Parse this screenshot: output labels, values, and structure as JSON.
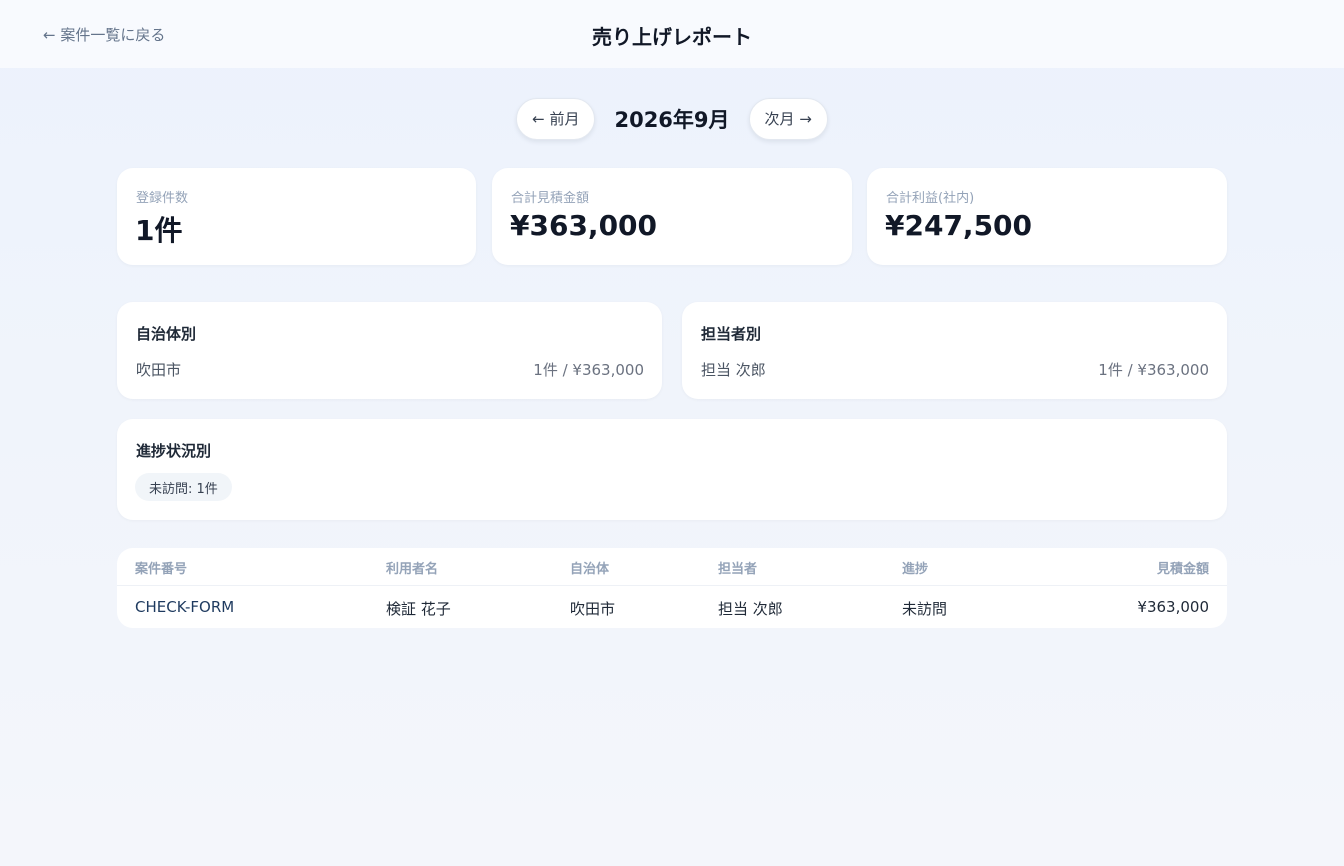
{
  "header": {
    "back_label": "← 案件一覧に戻る",
    "title": "売り上げレポート"
  },
  "month_nav": {
    "prev_label": "← 前月",
    "current": "2026年9月",
    "next_label": "次月 →"
  },
  "stats": [
    {
      "label": "登録件数",
      "value": "1件"
    },
    {
      "label": "合計見積金額",
      "value": "¥363,000"
    },
    {
      "label": "合計利益(社内)",
      "value": "¥247,500"
    }
  ],
  "by_municipality": {
    "title": "自治体別",
    "rows": [
      {
        "name": "吹田市",
        "value": "1件 / ¥363,000"
      }
    ]
  },
  "by_staff": {
    "title": "担当者別",
    "rows": [
      {
        "name": "担当 次郎",
        "value": "1件 / ¥363,000"
      }
    ]
  },
  "by_progress": {
    "title": "進捗状況別",
    "chips": [
      "未訪問: 1件"
    ]
  },
  "table": {
    "columns": [
      "案件番号",
      "利用者名",
      "自治体",
      "担当者",
      "進捗",
      "見積金額"
    ],
    "rows": [
      [
        "CHECK-FORM",
        "検証 花子",
        "吹田市",
        "担当 次郎",
        "未訪問",
        "¥363,000"
      ]
    ]
  },
  "colors": {
    "background": "#eef3fc",
    "card": "#ffffff",
    "title_text": "#111827",
    "muted_text": "#94a3b8",
    "link_text": "#1e3a5f"
  }
}
